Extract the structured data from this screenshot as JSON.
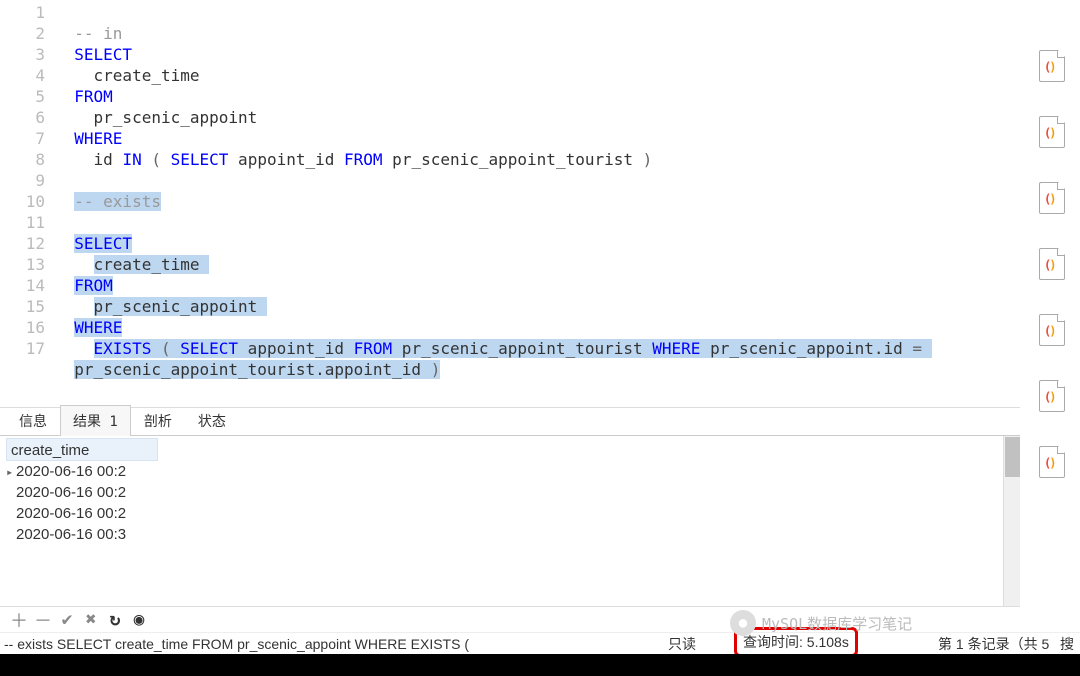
{
  "editor": {
    "lines": [
      {
        "n": 1,
        "tokens": []
      },
      {
        "n": 2,
        "tokens": [
          {
            "t": "  ",
            "c": ""
          },
          {
            "t": "-- in",
            "c": "cm"
          }
        ]
      },
      {
        "n": 3,
        "tokens": [
          {
            "t": "  ",
            "c": ""
          },
          {
            "t": "SELECT",
            "c": "kw"
          }
        ]
      },
      {
        "n": 4,
        "tokens": [
          {
            "t": "    create_time",
            "c": "ident"
          }
        ]
      },
      {
        "n": 5,
        "tokens": [
          {
            "t": "  ",
            "c": ""
          },
          {
            "t": "FROM",
            "c": "kw"
          }
        ]
      },
      {
        "n": 6,
        "tokens": [
          {
            "t": "    pr_scenic_appoint",
            "c": "ident"
          }
        ]
      },
      {
        "n": 7,
        "tokens": [
          {
            "t": "  ",
            "c": ""
          },
          {
            "t": "WHERE",
            "c": "kw"
          }
        ]
      },
      {
        "n": 8,
        "tokens": [
          {
            "t": "    id ",
            "c": "ident"
          },
          {
            "t": "IN",
            "c": "kw"
          },
          {
            "t": " ",
            "c": ""
          },
          {
            "t": "(",
            "c": "op"
          },
          {
            "t": " ",
            "c": ""
          },
          {
            "t": "SELECT",
            "c": "kw"
          },
          {
            "t": " appoint_id ",
            "c": "ident"
          },
          {
            "t": "FROM",
            "c": "kw"
          },
          {
            "t": " pr_scenic_appoint_tourist ",
            "c": "ident"
          },
          {
            "t": ")",
            "c": "op"
          }
        ]
      },
      {
        "n": 9,
        "tokens": []
      },
      {
        "n": 10,
        "sel": true,
        "tokens": [
          {
            "t": "  ",
            "c": ""
          },
          {
            "t": "-- exists",
            "c": "cm",
            "s": true
          }
        ]
      },
      {
        "n": 11,
        "sel": true,
        "tokens": [
          {
            "t": "  ",
            "c": ""
          }
        ]
      },
      {
        "n": 12,
        "sel": true,
        "tokens": [
          {
            "t": "  ",
            "c": ""
          },
          {
            "t": "SELECT",
            "c": "kw",
            "s": true
          }
        ]
      },
      {
        "n": 13,
        "sel": true,
        "tokens": [
          {
            "t": "    ",
            "c": ""
          },
          {
            "t": "create_time ",
            "c": "ident",
            "s": true
          }
        ]
      },
      {
        "n": 14,
        "sel": true,
        "tokens": [
          {
            "t": "  ",
            "c": ""
          },
          {
            "t": "FROM",
            "c": "kw",
            "s": true
          }
        ]
      },
      {
        "n": 15,
        "sel": true,
        "tokens": [
          {
            "t": "    ",
            "c": ""
          },
          {
            "t": "pr_scenic_appoint ",
            "c": "ident",
            "s": true
          }
        ]
      },
      {
        "n": 16,
        "sel": true,
        "tokens": [
          {
            "t": "  ",
            "c": ""
          },
          {
            "t": "WHERE",
            "c": "kw",
            "s": true
          }
        ]
      },
      {
        "n": 17,
        "sel": true,
        "tokens": [
          {
            "t": "    ",
            "c": ""
          },
          {
            "t": "EXISTS",
            "c": "kw",
            "s": true
          },
          {
            "t": " ",
            "c": "",
            "s": true
          },
          {
            "t": "(",
            "c": "op",
            "s": true
          },
          {
            "t": " ",
            "c": "",
            "s": true
          },
          {
            "t": "SELECT",
            "c": "kw",
            "s": true
          },
          {
            "t": " appoint_id ",
            "c": "ident",
            "s": true
          },
          {
            "t": "FROM",
            "c": "kw",
            "s": true
          },
          {
            "t": " pr_scenic_appoint_tourist ",
            "c": "ident",
            "s": true
          },
          {
            "t": "WHERE",
            "c": "kw",
            "s": true
          },
          {
            "t": " pr_scenic_appoint.id ",
            "c": "ident",
            "s": true
          },
          {
            "t": "=",
            "c": "op",
            "s": true
          },
          {
            "t": " ",
            "c": "",
            "s": true
          }
        ]
      },
      {
        "n": "",
        "sel": true,
        "tokens": [
          {
            "t": "  ",
            "c": ""
          },
          {
            "t": "pr_scenic_appoint_tourist.appoint_id ",
            "c": "ident",
            "s": true
          },
          {
            "t": ")",
            "c": "op",
            "s": true
          }
        ]
      }
    ]
  },
  "tabs": {
    "items": [
      {
        "label": "信息",
        "active": false
      },
      {
        "label": "结果 1",
        "active": true
      },
      {
        "label": "剖析",
        "active": false
      },
      {
        "label": "状态",
        "active": false
      }
    ]
  },
  "result": {
    "column": "create_time",
    "rows": [
      {
        "cur": true,
        "v": "2020-06-16 00:2"
      },
      {
        "cur": false,
        "v": "2020-06-16 00:2"
      },
      {
        "cur": false,
        "v": "2020-06-16 00:2"
      },
      {
        "cur": false,
        "v": "2020-06-16 00:3"
      }
    ]
  },
  "toolbar": {
    "add": "＋",
    "remove": "－",
    "apply": "✔",
    "cancel": "✖",
    "refresh": "↻",
    "stop": "◉"
  },
  "status": {
    "sql": "-- exists  SELECT       create_time  FROM    pr_scenic_appoint  WHERE       EXISTS (",
    "readonly": "只读",
    "querytime": "查询时间: 5.108s",
    "records": "第 1 条记录（共 5",
    "search": "搜"
  },
  "overlay": {
    "text": "MySQL数据库学习笔记"
  }
}
